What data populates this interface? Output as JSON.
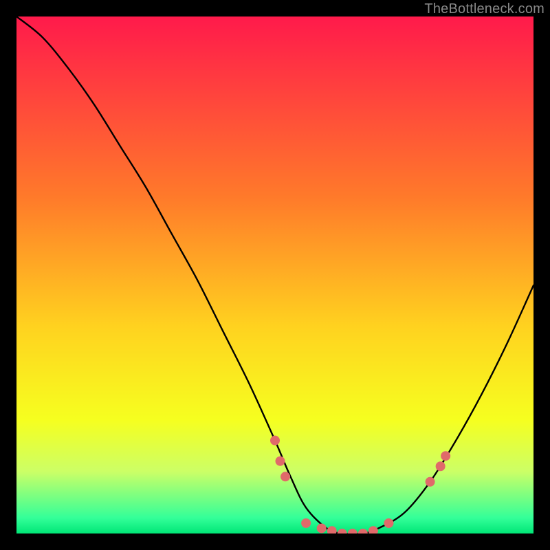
{
  "attribution": "TheBottleneck.com",
  "chart_data": {
    "type": "line",
    "title": "",
    "xlabel": "",
    "ylabel": "",
    "xlim": [
      0,
      100
    ],
    "ylim": [
      0,
      100
    ],
    "background_gradient": {
      "stops": [
        {
          "offset": 0.0,
          "color": "#ff1a4b"
        },
        {
          "offset": 0.35,
          "color": "#ff7a2a"
        },
        {
          "offset": 0.6,
          "color": "#ffd21f"
        },
        {
          "offset": 0.78,
          "color": "#f6ff1f"
        },
        {
          "offset": 0.88,
          "color": "#ccff66"
        },
        {
          "offset": 0.97,
          "color": "#33ff99"
        },
        {
          "offset": 1.0,
          "color": "#00e676"
        }
      ]
    },
    "series": [
      {
        "name": "bottleneck-curve",
        "x": [
          0,
          5,
          10,
          15,
          20,
          25,
          30,
          35,
          40,
          45,
          50,
          53,
          56,
          60,
          63,
          67,
          70,
          75,
          80,
          85,
          90,
          95,
          100
        ],
        "y": [
          100,
          96,
          90,
          83,
          75,
          67,
          58,
          49,
          39,
          29,
          18,
          11,
          5,
          1,
          0,
          0,
          1,
          4,
          10,
          18,
          27,
          37,
          48
        ]
      }
    ],
    "markers": {
      "name": "highlight-points",
      "color": "#e06a6a",
      "radius": 7,
      "points": [
        {
          "x": 50,
          "y": 18
        },
        {
          "x": 51,
          "y": 14
        },
        {
          "x": 52,
          "y": 11
        },
        {
          "x": 56,
          "y": 2
        },
        {
          "x": 59,
          "y": 1
        },
        {
          "x": 61,
          "y": 0.5
        },
        {
          "x": 63,
          "y": 0
        },
        {
          "x": 65,
          "y": 0
        },
        {
          "x": 67,
          "y": 0
        },
        {
          "x": 69,
          "y": 0.5
        },
        {
          "x": 72,
          "y": 2
        },
        {
          "x": 80,
          "y": 10
        },
        {
          "x": 82,
          "y": 13
        },
        {
          "x": 83,
          "y": 15
        }
      ]
    }
  }
}
